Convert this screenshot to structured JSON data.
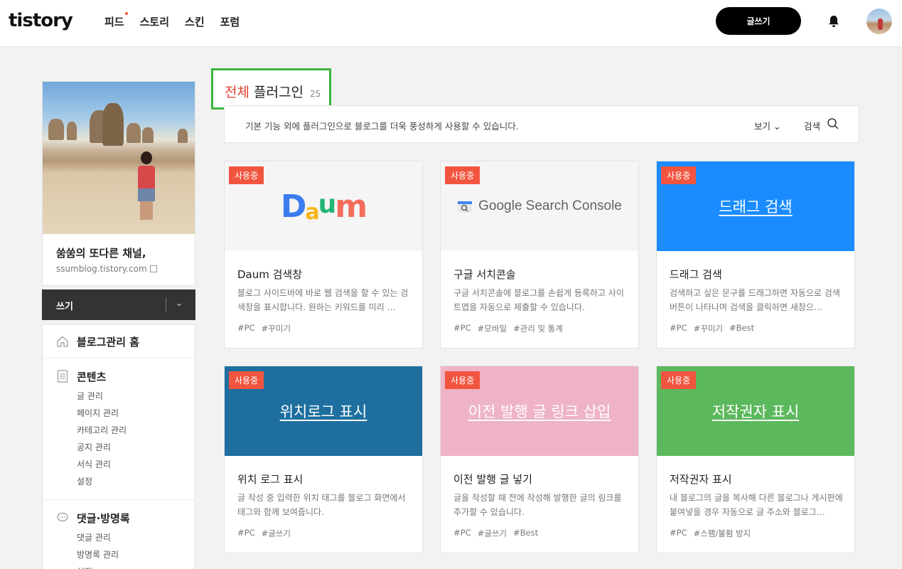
{
  "header": {
    "logo": "tistory",
    "nav": [
      "피드",
      "스토리",
      "스킨",
      "포럼"
    ],
    "write_button": "글쓰기"
  },
  "sidebar": {
    "blog_name": "쑴쑴의 또다른 채널,",
    "blog_url": "ssumblog.tistory.com",
    "write_label": "쓰기",
    "home_label": "블로그관리 홈",
    "sections": [
      {
        "title": "콘텐츠",
        "items": [
          "글 관리",
          "페이지 관리",
          "카테고리 관리",
          "공지 관리",
          "서식 관리",
          "설정"
        ]
      },
      {
        "title": "댓글·방명록",
        "items": [
          "댓글 관리",
          "방명록 관리",
          "설정"
        ]
      }
    ]
  },
  "main": {
    "title_prefix": "전체",
    "title": "플러그인",
    "count": "25",
    "description": "기본 기능 외에 플러그인으로 블로그를 더욱 풍성하게 사용할 수 있습니다.",
    "view_label": "보기",
    "search_label": "검색"
  },
  "cards": [
    {
      "badge": "사용중",
      "logo_text": "Daum",
      "title": "Daum 검색창",
      "desc": "블로그 사이드바에 바로 웹 검색을 할 수 있는 검색창을 표시합니다. 원하는 키워드를 미리 …",
      "tags": [
        "#PC",
        "#꾸미기"
      ],
      "head_color": "#f5f5f5"
    },
    {
      "badge": "사용중",
      "logo_text": "Google Search Console",
      "title": "구글 서치콘솔",
      "desc": "구글 서치콘솔에 블로그를 손쉽게 등록하고 사이트맵을 자동으로 제출할 수 있습니다.",
      "tags": [
        "#PC",
        "#모바일",
        "#관리 및 통계"
      ],
      "head_color": "#f5f5f5"
    },
    {
      "badge": "사용중",
      "head_text": "드래그 검색",
      "title": "드래그 검색",
      "desc": "검색하고 싶은 문구를 드래그하면 자동으로 검색 버튼이 나타나며 검색을 클릭하면 새창으…",
      "tags": [
        "#PC",
        "#꾸미기",
        "#Best"
      ],
      "head_color": "#1a8cff"
    },
    {
      "badge": "사용중",
      "head_text": "위치로그 표시",
      "title": "위치 로그 표시",
      "desc": "글 작성 중 입력한 위치 태그를 블로그 화면에서 태그와 함께 보여줍니다.",
      "tags": [
        "#PC",
        "#글쓰기"
      ],
      "head_color": "#1e6f9f"
    },
    {
      "badge": "사용중",
      "head_text": "이전 발행 글 링크 삽입",
      "title": "이전 발행 글 넣기",
      "desc": "글을 작성할 때 전에 작성해 발행한 글의 링크를 추가할 수 있습니다.",
      "tags": [
        "#PC",
        "#글쓰기",
        "#Best"
      ],
      "head_color": "#eeb3c6"
    },
    {
      "badge": "사용중",
      "head_text": "저작권자 표시",
      "title": "저작권자 표시",
      "desc": "내 블로그의 글을 복사해 다른 블로그나 게시판에 붙여넣을 경우 자동으로 글 주소와 블로그…",
      "tags": [
        "#PC",
        "#스팸/불펌 방지"
      ],
      "head_color": "#5cb85c"
    }
  ]
}
